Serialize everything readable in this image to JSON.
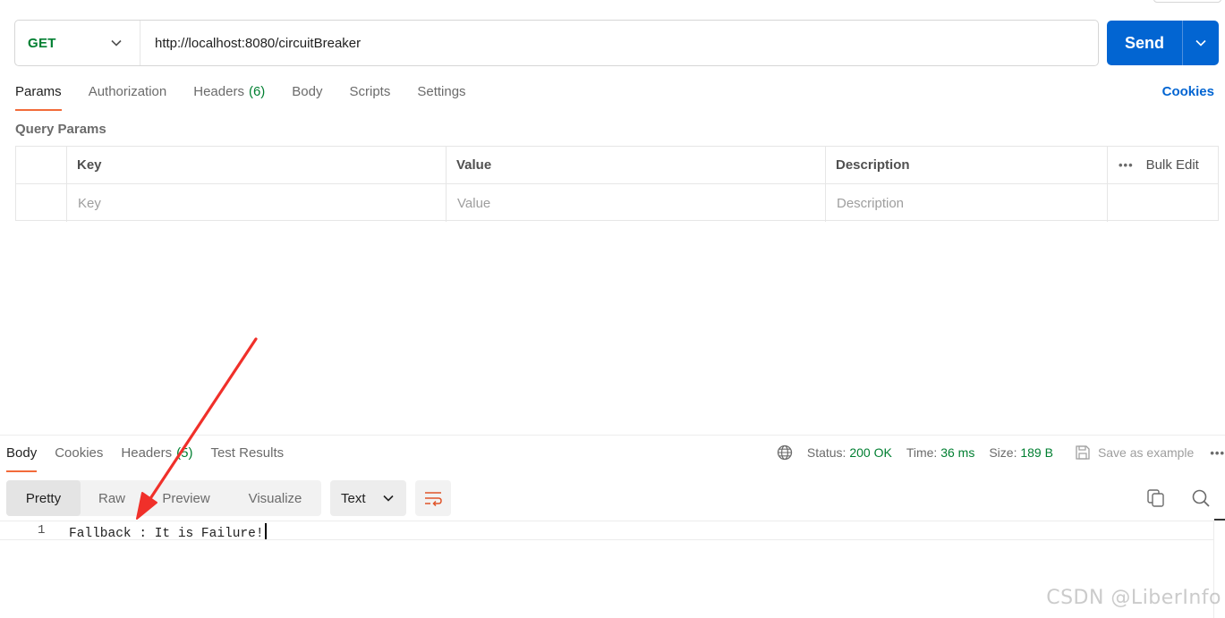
{
  "request": {
    "method": "GET",
    "url": "http://localhost:8080/circuitBreaker",
    "send_label": "Send"
  },
  "req_tabs": [
    {
      "label": "Params",
      "count": ""
    },
    {
      "label": "Authorization",
      "count": ""
    },
    {
      "label": "Headers",
      "count": "(6)"
    },
    {
      "label": "Body",
      "count": ""
    },
    {
      "label": "Scripts",
      "count": ""
    },
    {
      "label": "Settings",
      "count": ""
    }
  ],
  "cookies_label": "Cookies",
  "query_params": {
    "title": "Query Params",
    "columns": [
      "Key",
      "Value",
      "Description"
    ],
    "bulk_edit": "Bulk Edit",
    "placeholders": {
      "key": "Key",
      "value": "Value",
      "description": "Description"
    }
  },
  "response": {
    "tabs": [
      {
        "label": "Body",
        "count": ""
      },
      {
        "label": "Cookies",
        "count": ""
      },
      {
        "label": "Headers",
        "count": "(5)"
      },
      {
        "label": "Test Results",
        "count": ""
      }
    ],
    "status_label": "Status:",
    "status_value": "200 OK",
    "time_label": "Time:",
    "time_value": "36 ms",
    "size_label": "Size:",
    "size_value": "189 B",
    "save_example": "Save as example",
    "view_modes": [
      "Pretty",
      "Raw",
      "Preview",
      "Visualize"
    ],
    "format": "Text",
    "line_number": "1",
    "body_text": "Fallback : It is Failure!"
  },
  "watermark": "CSDN @LiberInfo",
  "colors": {
    "accent_blue": "#0265d2",
    "method_green": "#007f31",
    "tab_underline": "#f26b3a",
    "annotation_arrow": "#f0302a"
  },
  "icons": [
    "chevron-down-icon",
    "globe-icon",
    "save-icon",
    "more-icon",
    "wrap-icon",
    "copy-icon",
    "search-icon",
    "annotation-arrow"
  ]
}
